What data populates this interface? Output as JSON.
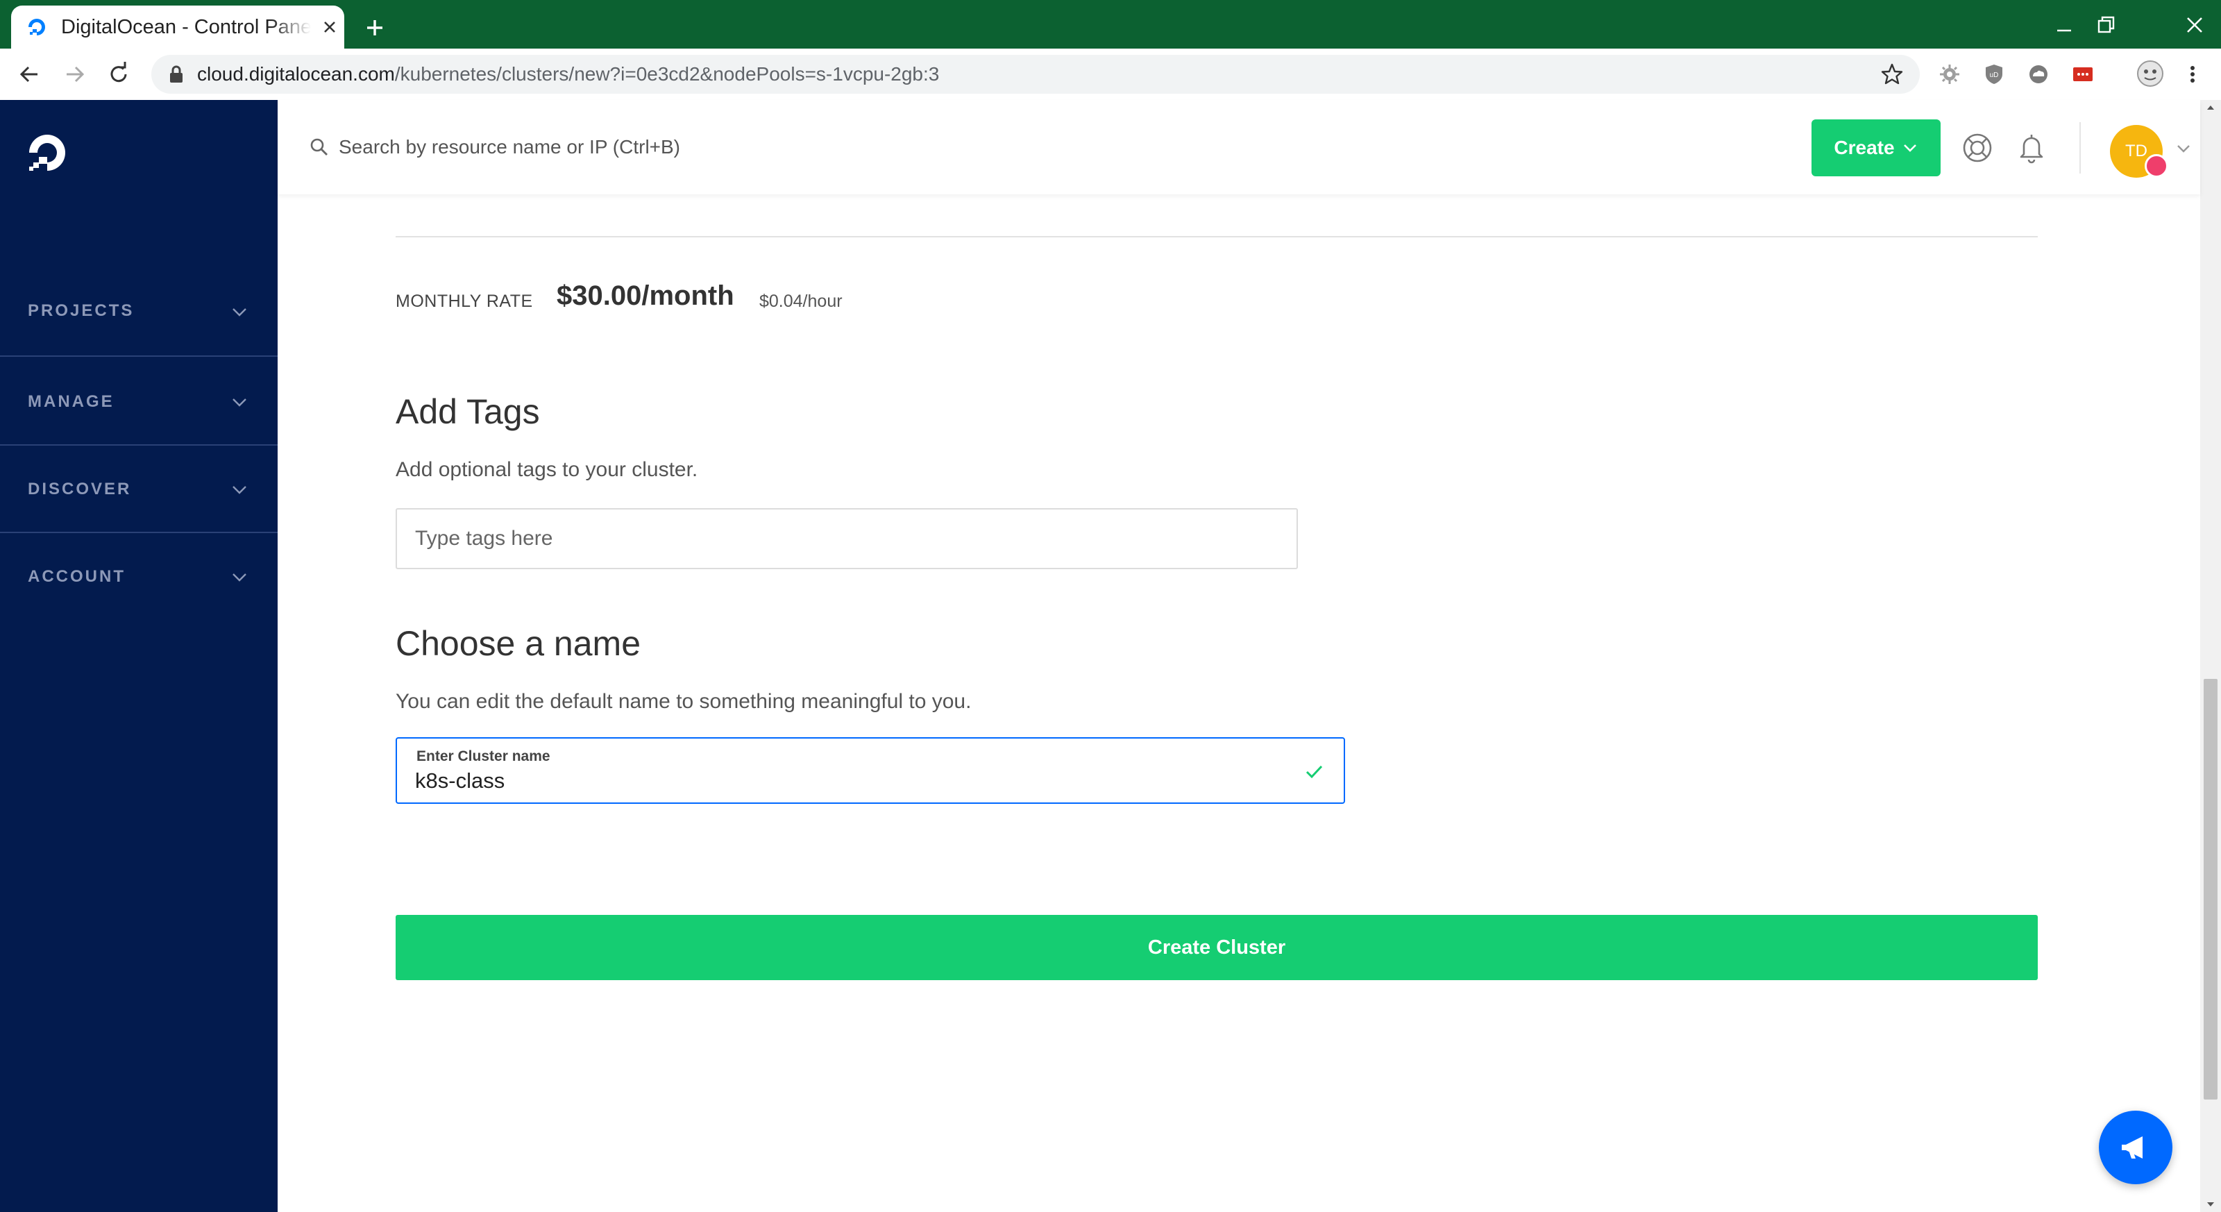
{
  "browser": {
    "tab_title": "DigitalOcean - Control Panel",
    "url_host": "cloud.digitalocean.com",
    "url_path": "/kubernetes/clusters/new?i=0e3cd2&nodePools=s-1vcpu-2gb:3"
  },
  "sidebar": {
    "items": [
      {
        "label": "PROJECTS"
      },
      {
        "label": "MANAGE"
      },
      {
        "label": "DISCOVER"
      },
      {
        "label": "ACCOUNT"
      }
    ]
  },
  "header": {
    "search_placeholder": "Search by resource name or IP (Ctrl+B)",
    "create_label": "Create",
    "avatar_initials": "TD"
  },
  "pricing": {
    "label": "MONTHLY RATE",
    "monthly": "$30.00/month",
    "hourly": "$0.04/hour"
  },
  "tags": {
    "title": "Add Tags",
    "description": "Add optional tags to your cluster.",
    "placeholder": "Type tags here"
  },
  "name_section": {
    "title": "Choose a name",
    "description": "You can edit the default name to something meaningful to you.",
    "field_label": "Enter Cluster name",
    "value": "k8s-class"
  },
  "actions": {
    "create_cluster": "Create Cluster"
  },
  "colors": {
    "sidebar_bg": "#031b4e",
    "primary_green": "#15cd72",
    "primary_blue": "#0069ff",
    "chrome_green": "#0c6131"
  }
}
